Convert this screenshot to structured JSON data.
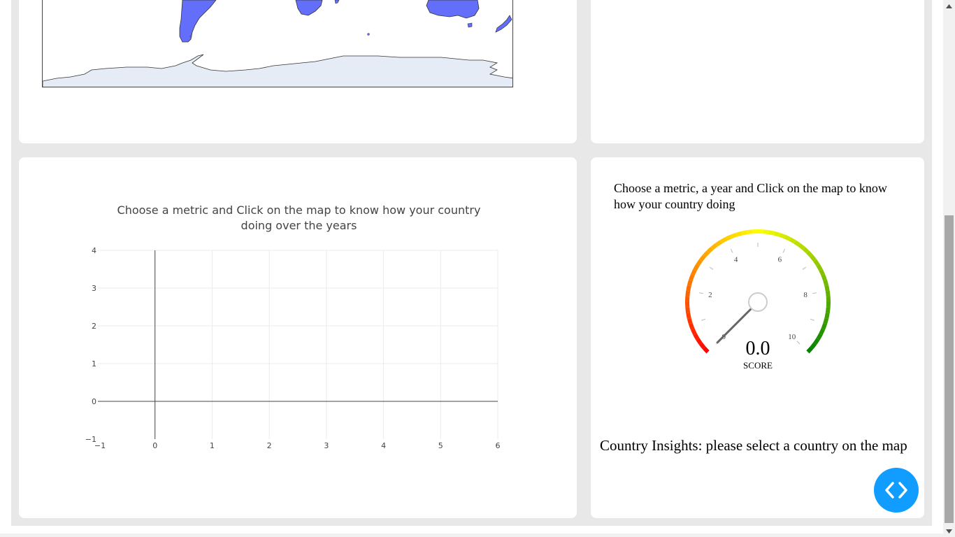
{
  "map_panel": {
    "land_color": "#636efa",
    "antarctica_color": "#e5ecf6"
  },
  "line_panel": {
    "title_line1": "Choose a metric and Click on the map to know how your country",
    "title_line2": "doing over the years",
    "chart_data": {
      "type": "line",
      "series": [],
      "xlim": [
        -1,
        6
      ],
      "ylim": [
        -1,
        4
      ],
      "x_ticks": [
        "−1",
        "0",
        "1",
        "2",
        "3",
        "4",
        "5",
        "6"
      ],
      "y_ticks": [
        "−1",
        "0",
        "1",
        "2",
        "3",
        "4"
      ],
      "grid": true
    }
  },
  "gauge_panel": {
    "title": "Choose a metric, a year and Click on the map to know how your country doing",
    "value_text": "0.0",
    "label": "SCORE",
    "value": 0,
    "range": [
      0,
      10
    ],
    "tick_labels": [
      "0",
      "2",
      "4",
      "6",
      "8",
      "10"
    ],
    "colors": {
      "low": "#ff0000",
      "mid": "#ffff00",
      "high": "#008000"
    }
  },
  "insights": {
    "text": "Country Insights: please select a country on the map"
  },
  "fab": {
    "icon": "code-icon",
    "color": "#119dff"
  }
}
